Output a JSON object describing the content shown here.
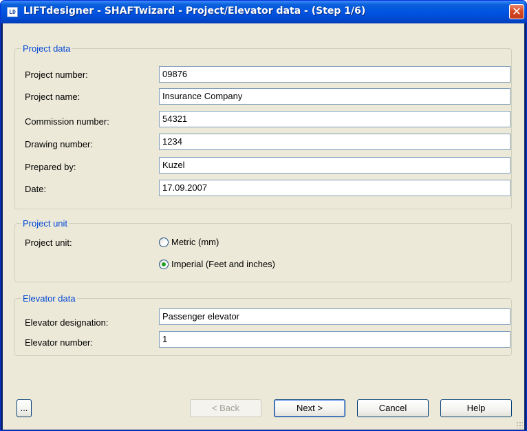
{
  "window": {
    "title": "LIFTdesigner - SHAFTwizard - Project/Elevator data - (Step 1/6)",
    "icon_text": "LD",
    "close_glyph": "✕",
    "icon_name": "liftdesigner-app-icon"
  },
  "project_data": {
    "group_title": "Project data",
    "fields": [
      {
        "label": "Project number:",
        "value": "09876"
      },
      {
        "label": "Project name:",
        "value": "Insurance Company"
      },
      {
        "label": "Commission number:",
        "value": "54321"
      },
      {
        "label": "Drawing number:",
        "value": "1234"
      },
      {
        "label": "Prepared by:",
        "value": "Kuzel"
      },
      {
        "label": "Date:",
        "value": "17.09.2007"
      }
    ]
  },
  "project_unit": {
    "group_title": "Project unit",
    "label": "Project unit:",
    "options": [
      {
        "label": "Metric (mm)",
        "checked": false
      },
      {
        "label": "Imperial (Feet and inches)",
        "checked": true
      }
    ]
  },
  "elevator_data": {
    "group_title": "Elevator data",
    "fields": [
      {
        "label": "Elevator designation:",
        "value": "Passenger elevator"
      },
      {
        "label": "Elevator number:",
        "value": "1"
      }
    ]
  },
  "buttons": {
    "more": "...",
    "back": "< Back",
    "next": "Next >",
    "cancel": "Cancel",
    "help": "Help"
  },
  "colors": {
    "titlebar": "#0054e3",
    "group_title": "#0046d5",
    "dialog_bg": "#ece9d8",
    "radio_dot": "#21a121"
  }
}
